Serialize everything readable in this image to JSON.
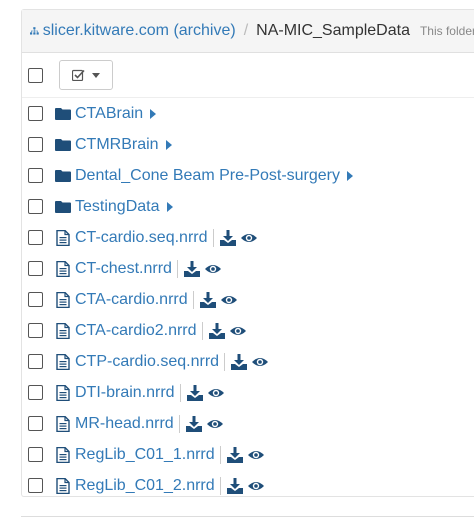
{
  "breadcrumb": {
    "root_label": "slicer.kitware.com (archive)",
    "separator": "/",
    "current": "NA-MIC_SampleData",
    "description": "This folder i"
  },
  "items": [
    {
      "type": "folder",
      "name": "CTABrain"
    },
    {
      "type": "folder",
      "name": "CTMRBrain"
    },
    {
      "type": "folder",
      "name": "Dental_Cone Beam Pre-Post-surgery"
    },
    {
      "type": "folder",
      "name": "TestingData"
    },
    {
      "type": "file",
      "name": "CT-cardio.seq.nrrd"
    },
    {
      "type": "file",
      "name": "CT-chest.nrrd"
    },
    {
      "type": "file",
      "name": "CTA-cardio.nrrd"
    },
    {
      "type": "file",
      "name": "CTA-cardio2.nrrd"
    },
    {
      "type": "file",
      "name": "CTP-cardio.seq.nrrd"
    },
    {
      "type": "file",
      "name": "DTI-brain.nrrd"
    },
    {
      "type": "file",
      "name": "MR-head.nrrd"
    },
    {
      "type": "file",
      "name": "RegLib_C01_1.nrrd"
    },
    {
      "type": "file",
      "name": "RegLib_C01_2.nrrd"
    }
  ],
  "colors": {
    "link": "#337ab7",
    "icon": "#1f4e79"
  }
}
